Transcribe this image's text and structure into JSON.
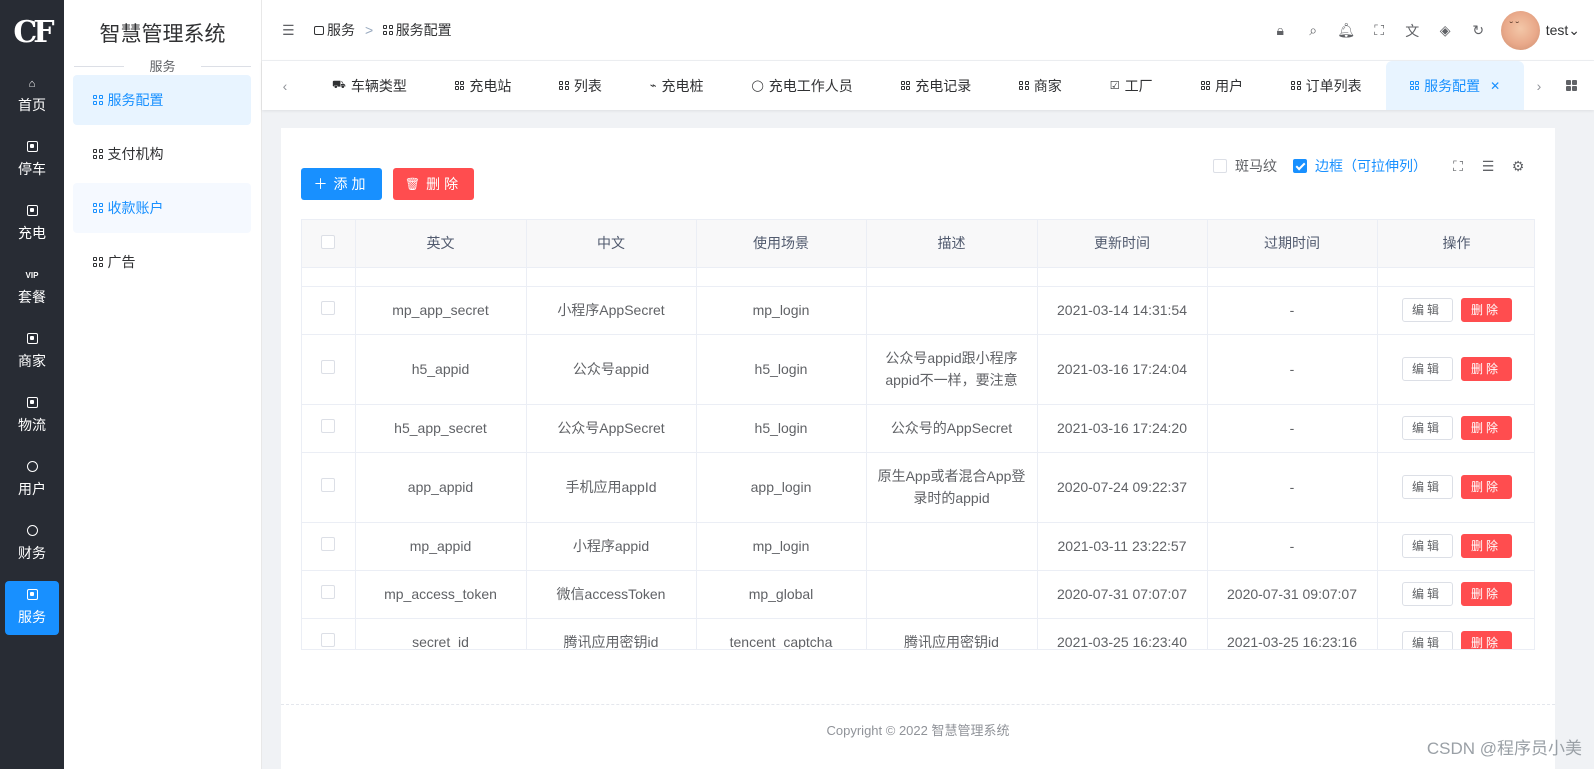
{
  "rail": {
    "logo": "CF",
    "items": [
      {
        "label": "首页"
      },
      {
        "label": "停车"
      },
      {
        "label": "充电"
      },
      {
        "label": "套餐"
      },
      {
        "label": "商家"
      },
      {
        "label": "物流"
      },
      {
        "label": "用户"
      },
      {
        "label": "财务"
      },
      {
        "label": "服务"
      }
    ]
  },
  "submenu": {
    "title": "智慧管理系统",
    "section": "服务",
    "items": [
      {
        "label": "服务配置"
      },
      {
        "label": "支付机构"
      },
      {
        "label": "收款账户"
      },
      {
        "label": "广告"
      }
    ]
  },
  "header": {
    "breadcrumb": [
      "服务",
      "服务配置"
    ],
    "separator": ">",
    "username": "test"
  },
  "tabs": [
    {
      "label": "车辆类型"
    },
    {
      "label": "充电站"
    },
    {
      "label": "列表"
    },
    {
      "label": "充电桩"
    },
    {
      "label": "充电工作人员"
    },
    {
      "label": "充电记录"
    },
    {
      "label": "商家"
    },
    {
      "label": "工厂"
    },
    {
      "label": "用户"
    },
    {
      "label": "订单列表"
    },
    {
      "label": "服务配置"
    }
  ],
  "toolbar": {
    "add_label": "添加",
    "delete_label": "删除",
    "stripe_label": "斑马纹",
    "border_label": "边框（可拉伸列）"
  },
  "table": {
    "headers": [
      "英文",
      "中文",
      "使用场景",
      "描述",
      "更新时间",
      "过期时间",
      "操作"
    ],
    "edit_label": "编辑",
    "delete_label": "删除",
    "rows": [
      {
        "en": "mp_app_secret",
        "zh": "小程序AppSecret",
        "scene": "mp_login",
        "desc": "",
        "updated": "2021-03-14 14:31:54",
        "expires": "-"
      },
      {
        "en": "h5_appid",
        "zh": "公众号appid",
        "scene": "h5_login",
        "desc": "公众号appid跟小程序appid不一样，要注意",
        "updated": "2021-03-16 17:24:04",
        "expires": "-"
      },
      {
        "en": "h5_app_secret",
        "zh": "公众号AppSecret",
        "scene": "h5_login",
        "desc": "公众号的AppSecret",
        "updated": "2021-03-16 17:24:20",
        "expires": "-"
      },
      {
        "en": "app_appid",
        "zh": "手机应用appId",
        "scene": "app_login",
        "desc": "原生App或者混合App登录时的appid",
        "updated": "2020-07-24 09:22:37",
        "expires": "-"
      },
      {
        "en": "mp_appid",
        "zh": "小程序appid",
        "scene": "mp_login",
        "desc": "",
        "updated": "2021-03-11 23:22:57",
        "expires": "-"
      },
      {
        "en": "mp_access_token",
        "zh": "微信accessToken",
        "scene": "mp_global",
        "desc": "",
        "updated": "2020-07-31 07:07:07",
        "expires": "2020-07-31 09:07:07"
      },
      {
        "en": "secret_id",
        "zh": "腾讯应用密钥id",
        "scene": "tencent_captcha",
        "desc": "腾讯应用密钥id",
        "updated": "2021-03-25 16:23:40",
        "expires": "2021-03-25 16:23:16"
      }
    ]
  },
  "footer": {
    "copyright": "Copyright © 2022 智慧管理系统"
  },
  "watermark": "CSDN @程序员小美",
  "colors": {
    "primary": "#1890ff",
    "danger": "#ff4d4f",
    "rail_bg": "#282c34"
  }
}
